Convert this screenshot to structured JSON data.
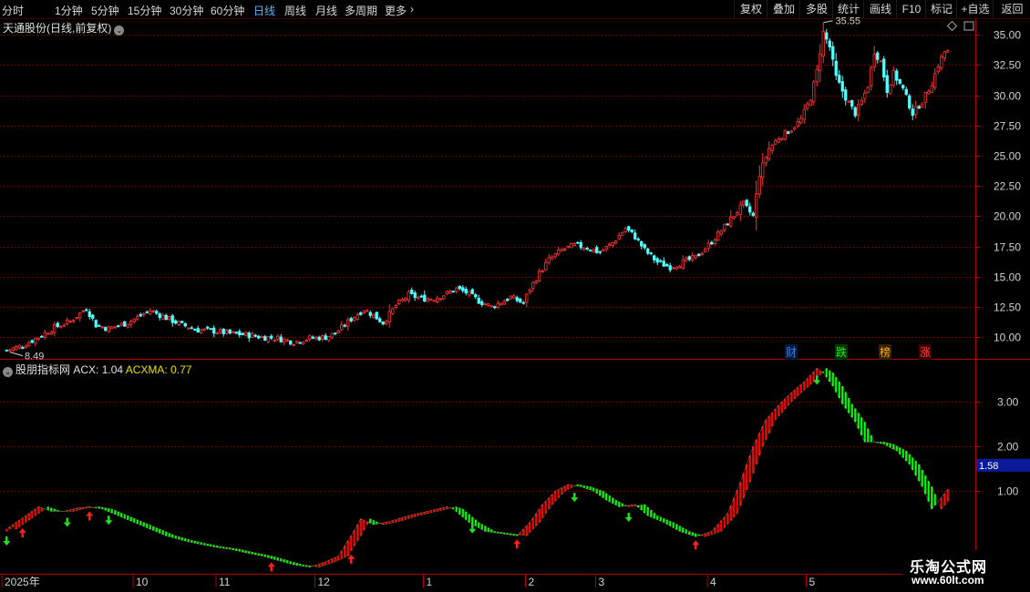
{
  "toolbar": {
    "timeframes": [
      "分时",
      "1分钟",
      "5分钟",
      "15分钟",
      "30分钟",
      "60分钟",
      "日线",
      "周线",
      "月线",
      "多周期",
      "更多"
    ],
    "active_timeframe": "日线",
    "more_arrow": "›",
    "right_buttons": [
      "复权",
      "叠加",
      "多股",
      "统计",
      "画线",
      "F10",
      "标记",
      "+自选",
      "返回"
    ]
  },
  "main_panel": {
    "title": "天通股份(日线,前复权)",
    "high_label": "35.55",
    "low_label": "8.49",
    "price_ticks": [
      "35.00",
      "32.50",
      "30.00",
      "27.50",
      "25.00",
      "22.50",
      "20.00",
      "17.50",
      "15.00",
      "12.50",
      "10.00"
    ],
    "badges": [
      {
        "text": "财",
        "color": "#3a7bff",
        "bg": "#001a3a"
      },
      {
        "text": "跌",
        "color": "#30e030",
        "bg": "#003a00"
      },
      {
        "text": "榜",
        "color": "#ffb000",
        "bg": "#3a2000"
      },
      {
        "text": "涨",
        "color": "#ff4040",
        "bg": "#3a0000"
      }
    ]
  },
  "indicator_panel": {
    "title": "股朋指标网",
    "acx_label": "ACX:",
    "acx_value": "1.04",
    "acxma_label": "ACXMA:",
    "acxma_value": "0.77",
    "ticks": [
      "3.00",
      "2.00",
      "1.00"
    ],
    "current_marker": "1.58"
  },
  "x_axis": {
    "labels": [
      "2025年",
      "10",
      "11",
      "12",
      "1",
      "2",
      "3",
      "4",
      "5"
    ]
  },
  "watermark": {
    "line1": "乐淘公式网",
    "line2": "www.60lt.com"
  },
  "colors": {
    "up": "#ff3232",
    "down": "#54ffff",
    "acx_up": "#ff0000",
    "acx_down": "#00ff00",
    "grid": "#8a0000",
    "active_tab": "#5ab4ff"
  },
  "chart_data": [
    {
      "type": "candlestick",
      "title": "天通股份(日线,前复权)",
      "ylim": [
        8.2,
        36.3
      ],
      "ticks": [
        10.0,
        12.5,
        15.0,
        17.5,
        20.0,
        22.5,
        25.0,
        27.5,
        30.0,
        32.5,
        35.0
      ],
      "low_annotation": 8.49,
      "high_annotation": 35.55,
      "close_keyframes": [
        [
          0,
          8.9
        ],
        [
          5,
          9.3
        ],
        [
          10,
          10.0
        ],
        [
          15,
          10.8
        ],
        [
          20,
          11.3
        ],
        [
          25,
          12.4
        ],
        [
          28,
          11.0
        ],
        [
          32,
          10.7
        ],
        [
          38,
          11.2
        ],
        [
          45,
          12.2
        ],
        [
          50,
          11.6
        ],
        [
          55,
          11.0
        ],
        [
          60,
          10.6
        ],
        [
          65,
          10.5
        ],
        [
          70,
          10.3
        ],
        [
          75,
          10.2
        ],
        [
          80,
          10.0
        ],
        [
          85,
          9.9
        ],
        [
          90,
          9.6
        ],
        [
          95,
          9.9
        ],
        [
          100,
          10.0
        ],
        [
          103,
          10.3
        ],
        [
          108,
          11.5
        ],
        [
          112,
          12.3
        ],
        [
          115,
          11.8
        ],
        [
          118,
          11.2
        ],
        [
          122,
          12.6
        ],
        [
          126,
          13.5
        ],
        [
          130,
          13.2
        ],
        [
          134,
          13.2
        ],
        [
          138,
          13.6
        ],
        [
          141,
          14.0
        ],
        [
          144,
          13.7
        ],
        [
          148,
          13.0
        ],
        [
          152,
          12.5
        ],
        [
          155,
          12.9
        ],
        [
          158,
          13.3
        ],
        [
          162,
          12.8
        ],
        [
          164,
          14.0
        ],
        [
          167,
          15.3
        ],
        [
          170,
          16.4
        ],
        [
          174,
          17.2
        ],
        [
          178,
          17.6
        ],
        [
          182,
          17.4
        ],
        [
          186,
          17.0
        ],
        [
          190,
          17.8
        ],
        [
          194,
          19.0
        ],
        [
          197,
          18.3
        ],
        [
          200,
          17.2
        ],
        [
          204,
          16.2
        ],
        [
          208,
          15.8
        ],
        [
          212,
          16.2
        ],
        [
          216,
          16.6
        ],
        [
          220,
          17.6
        ],
        [
          224,
          18.8
        ],
        [
          228,
          20.1
        ],
        [
          231,
          21.0
        ],
        [
          234,
          20.0
        ],
        [
          236,
          23.5
        ],
        [
          239,
          25.6
        ],
        [
          242,
          26.5
        ],
        [
          246,
          27.2
        ],
        [
          249,
          28.0
        ],
        [
          252,
          29.8
        ],
        [
          254,
          32.0
        ],
        [
          256,
          35.2
        ],
        [
          258,
          34.0
        ],
        [
          260,
          31.5
        ],
        [
          263,
          29.8
        ],
        [
          266,
          28.5
        ],
        [
          268,
          29.5
        ],
        [
          270,
          30.8
        ],
        [
          272,
          33.6
        ],
        [
          274,
          32.8
        ],
        [
          276,
          30.4
        ],
        [
          278,
          31.8
        ],
        [
          281,
          30.5
        ],
        [
          284,
          28.5
        ],
        [
          287,
          29.5
        ],
        [
          290,
          31.0
        ],
        [
          292,
          32.5
        ],
        [
          294,
          33.6
        ]
      ],
      "date_labels": [
        "2025年",
        "10",
        "11",
        "12",
        "1",
        "2",
        "3",
        "4",
        "5"
      ]
    },
    {
      "type": "area",
      "title": "股朋指标网",
      "series": [
        {
          "name": "ACX",
          "values_note": "last",
          "last": 1.04
        },
        {
          "name": "ACXMA",
          "last": 0.77
        }
      ],
      "ylim": [
        -0.85,
        3.9
      ],
      "ticks": [
        1.0,
        2.0,
        3.0
      ],
      "acx_keyframes": [
        [
          0,
          0.15
        ],
        [
          5,
          0.4
        ],
        [
          10,
          0.65
        ],
        [
          14,
          0.55
        ],
        [
          18,
          0.55
        ],
        [
          22,
          0.62
        ],
        [
          26,
          0.65
        ],
        [
          30,
          0.6
        ],
        [
          35,
          0.45
        ],
        [
          40,
          0.3
        ],
        [
          45,
          0.15
        ],
        [
          50,
          0.0
        ],
        [
          55,
          -0.1
        ],
        [
          60,
          -0.18
        ],
        [
          65,
          -0.25
        ],
        [
          70,
          -0.3
        ],
        [
          75,
          -0.38
        ],
        [
          80,
          -0.45
        ],
        [
          85,
          -0.55
        ],
        [
          90,
          -0.65
        ],
        [
          95,
          -0.7
        ],
        [
          100,
          -0.58
        ],
        [
          104,
          -0.45
        ],
        [
          108,
          0.0
        ],
        [
          111,
          0.38
        ],
        [
          115,
          0.25
        ],
        [
          120,
          0.32
        ],
        [
          126,
          0.45
        ],
        [
          132,
          0.55
        ],
        [
          138,
          0.65
        ],
        [
          140,
          0.6
        ],
        [
          145,
          0.3
        ],
        [
          150,
          0.1
        ],
        [
          155,
          0.05
        ],
        [
          160,
          0.0
        ],
        [
          164,
          0.3
        ],
        [
          168,
          0.7
        ],
        [
          172,
          1.0
        ],
        [
          176,
          1.15
        ],
        [
          180,
          1.1
        ],
        [
          184,
          1.0
        ],
        [
          188,
          0.8
        ],
        [
          192,
          0.65
        ],
        [
          197,
          0.7
        ],
        [
          201,
          0.45
        ],
        [
          206,
          0.3
        ],
        [
          211,
          0.1
        ],
        [
          216,
          -0.02
        ],
        [
          221,
          0.1
        ],
        [
          226,
          0.5
        ],
        [
          230,
          1.2
        ],
        [
          234,
          2.0
        ],
        [
          238,
          2.6
        ],
        [
          243,
          3.0
        ],
        [
          246,
          3.2
        ],
        [
          250,
          3.45
        ],
        [
          254,
          3.75
        ],
        [
          256,
          3.65
        ],
        [
          259,
          3.35
        ],
        [
          262,
          2.95
        ],
        [
          266,
          2.55
        ],
        [
          269,
          2.1
        ],
        [
          272,
          2.1
        ],
        [
          275,
          2.05
        ],
        [
          279,
          1.9
        ],
        [
          283,
          1.6
        ],
        [
          287,
          1.1
        ],
        [
          290,
          0.6
        ],
        [
          293,
          0.85
        ],
        [
          295,
          1.04
        ]
      ],
      "signals_up": [
        5,
        26,
        83,
        108,
        160,
        216
      ],
      "signals_down": [
        0,
        19,
        32,
        146,
        178,
        195,
        254
      ]
    }
  ]
}
